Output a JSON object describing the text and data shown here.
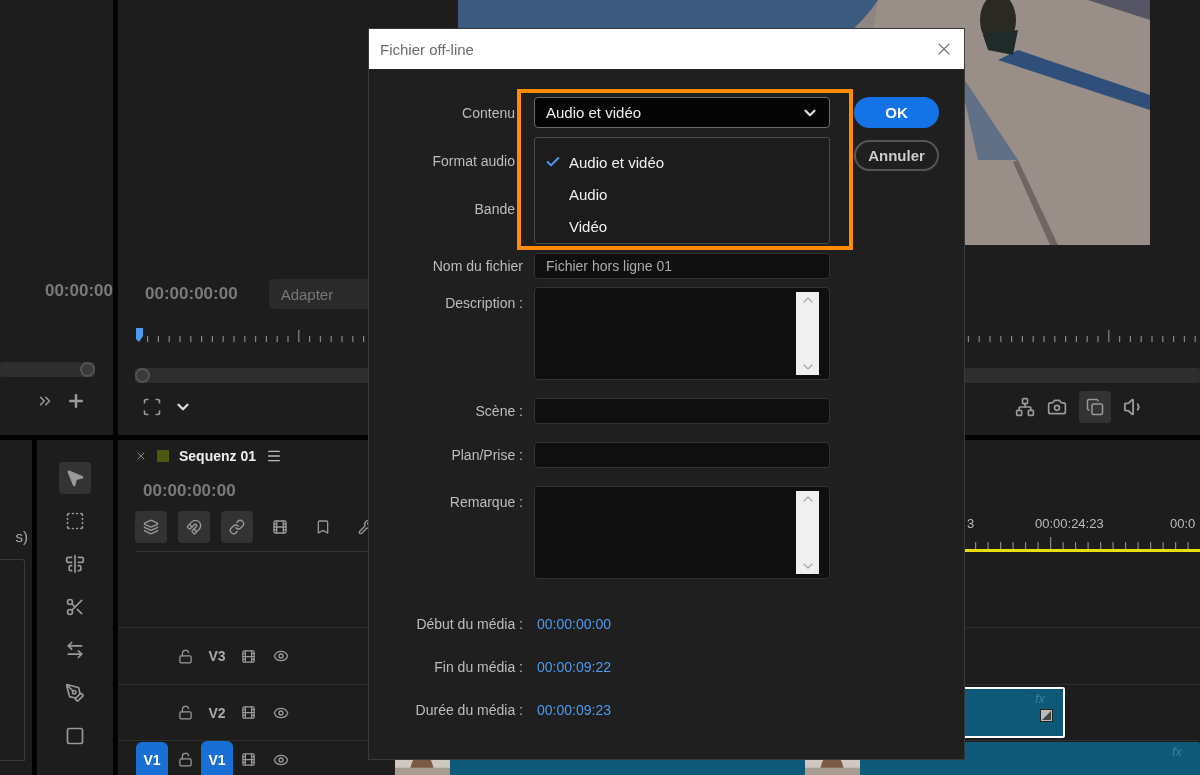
{
  "source_monitor": {
    "timecode": "00:00:00"
  },
  "program_monitor": {
    "timecode": "00:00:00:00",
    "fit": "Adapter"
  },
  "project_panel": {
    "text": "s)"
  },
  "tools": [
    {
      "kind": "selection",
      "selected": true
    },
    {
      "kind": "track_select",
      "selected": false
    },
    {
      "kind": "ripple",
      "selected": false
    },
    {
      "kind": "razor",
      "selected": false
    },
    {
      "kind": "slip",
      "selected": false
    },
    {
      "kind": "pen",
      "selected": false
    },
    {
      "kind": "rectangle",
      "selected": false
    }
  ],
  "timeline": {
    "title": "Sequenz 01",
    "timecode": "00:00:00:00",
    "buttons": [
      {
        "kind": "nest",
        "on": true
      },
      {
        "kind": "snap",
        "on": true
      },
      {
        "kind": "linked",
        "on": true
      },
      {
        "kind": "markers",
        "on": false
      },
      {
        "kind": "marker",
        "on": false
      },
      {
        "kind": "settings",
        "on": false
      }
    ],
    "ruler_labels": [
      "3",
      "00:00:24:23",
      "00:0"
    ],
    "tracks": [
      {
        "name": "V3",
        "targeted": false
      },
      {
        "name": "V2",
        "targeted": false,
        "clip": {
          "badge": "fx",
          "selected": true
        }
      },
      {
        "name": "V1",
        "targeted": true,
        "source_patch": "V1",
        "clip": {
          "badge": "fx",
          "selected": false
        }
      }
    ]
  },
  "dialog": {
    "title": "Fichier off-line",
    "fields": [
      {
        "kind": "select",
        "label": "Contenu",
        "value": "Audio et vidéo",
        "expanded": true,
        "options": [
          {
            "label": "Audio et vidéo",
            "selected": true
          },
          {
            "label": "Audio",
            "selected": false
          },
          {
            "label": "Vidéo",
            "selected": false
          }
        ]
      },
      {
        "kind": "covered",
        "label": "Format audio"
      },
      {
        "kind": "covered",
        "label": "Bande"
      },
      {
        "kind": "text",
        "label": "Nom du fichier",
        "value": "Fichier hors ligne 01"
      },
      {
        "kind": "textarea",
        "label": "Description :"
      },
      {
        "kind": "text",
        "label": "Scène :"
      },
      {
        "kind": "text",
        "label": "Plan/Prise :"
      },
      {
        "kind": "textarea",
        "label": "Remarque :"
      }
    ],
    "buttons": [
      {
        "label": "OK",
        "primary": true
      },
      {
        "label": "Annuler",
        "primary": false
      }
    ],
    "media_info": [
      {
        "label": "Début du média :",
        "value": "00:00:00:00"
      },
      {
        "label": "Fin du média :",
        "value": "00:00:09:22"
      },
      {
        "label": "Durée du média :",
        "value": "00:00:09:23"
      }
    ]
  }
}
